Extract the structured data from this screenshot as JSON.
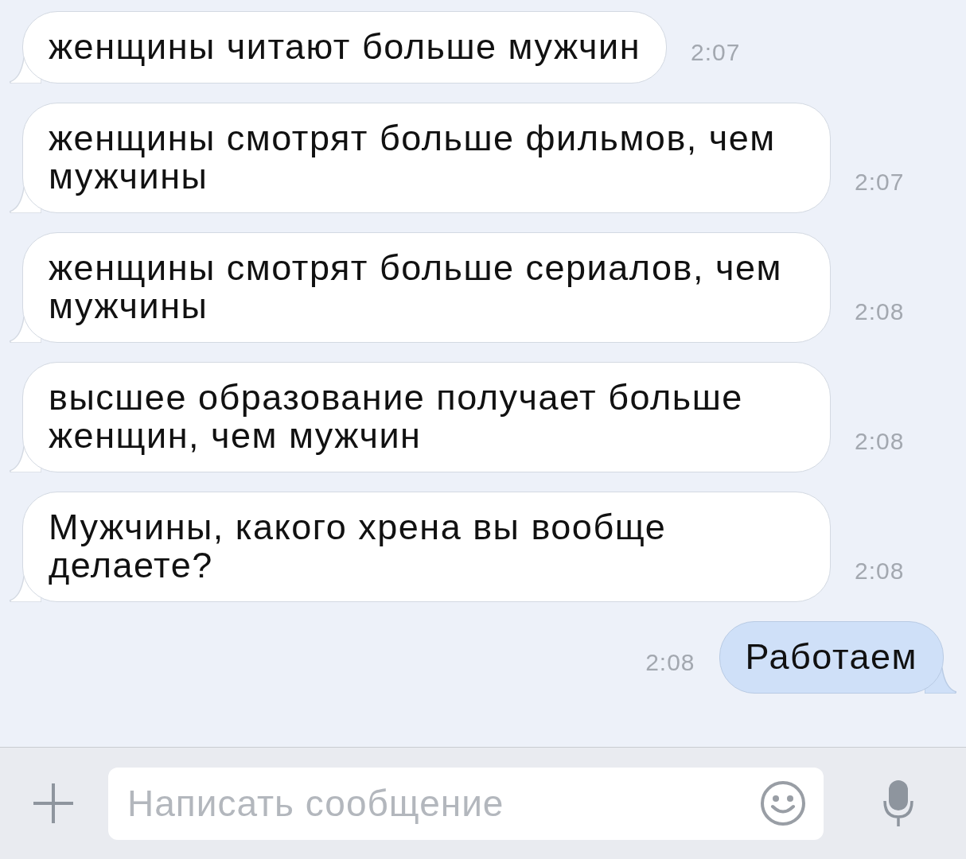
{
  "messages": [
    {
      "kind": "incoming",
      "text": "женщины читают больше мужчин",
      "time": "2:07"
    },
    {
      "kind": "incoming",
      "text": "женщины смотрят больше фильмов, чем мужчины",
      "time": "2:07"
    },
    {
      "kind": "incoming",
      "text": "женщины смотрят больше сериалов, чем мужчины",
      "time": "2:08"
    },
    {
      "kind": "incoming",
      "text": "высшее образование получает больше женщин, чем мужчин",
      "time": "2:08"
    },
    {
      "kind": "incoming",
      "text": "Мужчины, какого хрена вы вообще делаете?",
      "time": "2:08"
    },
    {
      "kind": "outgoing",
      "text": "Работаем",
      "time": "2:08"
    }
  ],
  "composer": {
    "placeholder": "Написать сообщение"
  }
}
